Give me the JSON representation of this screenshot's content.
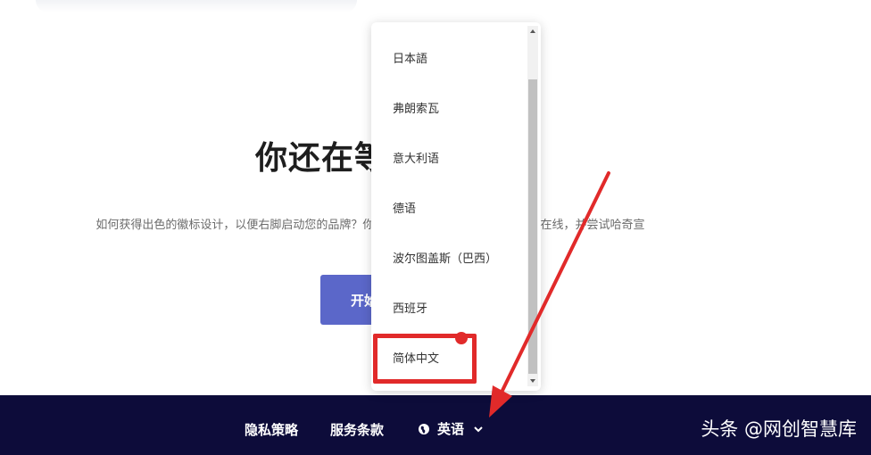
{
  "hero": {
    "title": "你还在等",
    "description": "如何获得出色的徽标设计，以便右脚启动您的品牌？你可以 业设计。或者，您可以跳联在线，并尝试哈奇宣",
    "cta_label": "开始"
  },
  "language_menu": {
    "items": [
      {
        "label": "日本語"
      },
      {
        "label": "弗朗索瓦"
      },
      {
        "label": "意大利语"
      },
      {
        "label": "德语"
      },
      {
        "label": "波尔图盖斯（巴西）"
      },
      {
        "label": "西班牙"
      },
      {
        "label": "简体中文"
      }
    ],
    "highlighted": "简体中文"
  },
  "footer": {
    "privacy_label": "隐私策略",
    "terms_label": "服务条款",
    "language_label": "英语",
    "watermark": "头条 @网创智慧库"
  },
  "colors": {
    "footer_bg": "#0d0c3a",
    "cta_bg": "#5b67c9",
    "annotation_red": "#e12a2a"
  }
}
